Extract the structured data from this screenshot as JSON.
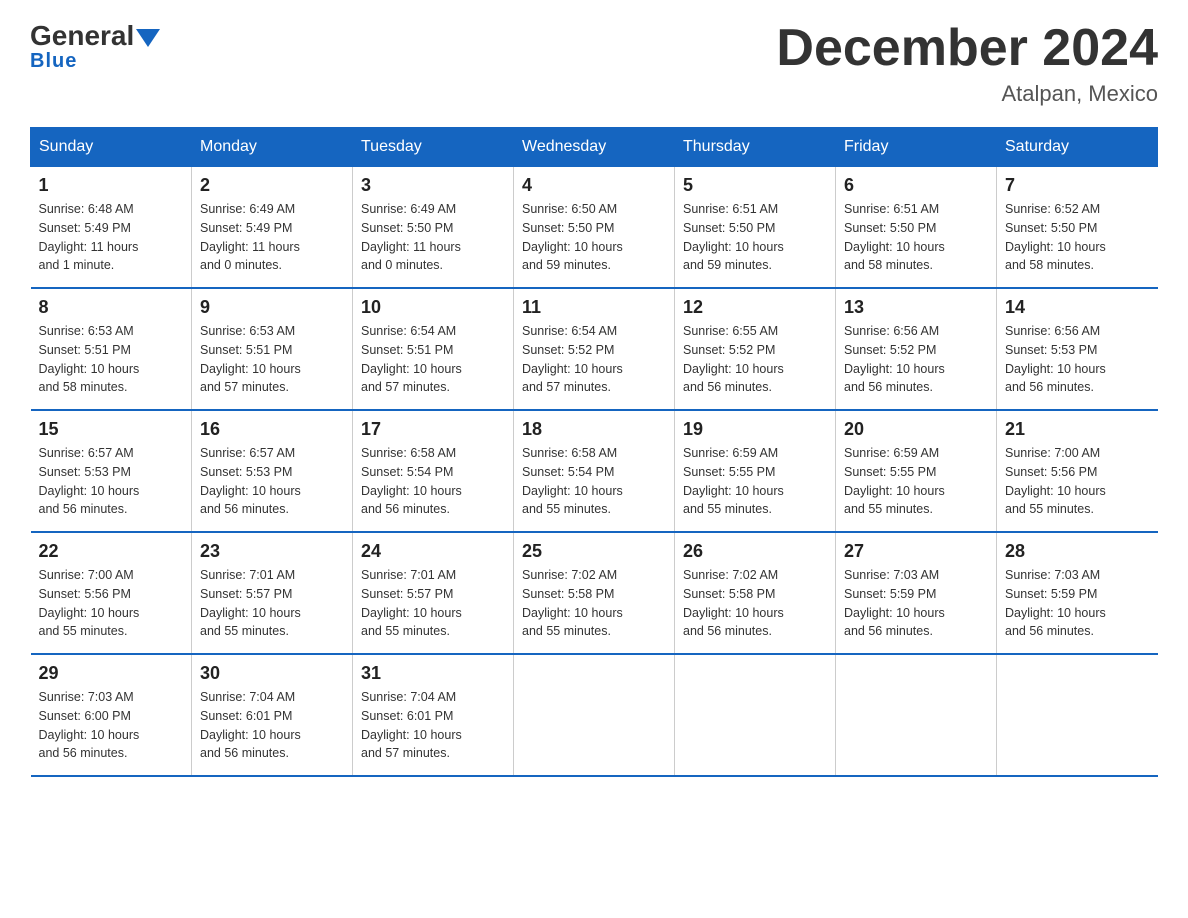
{
  "logo": {
    "general": "General",
    "blue": "Blue",
    "subtitle": "Blue"
  },
  "header": {
    "title": "December 2024",
    "location": "Atalpan, Mexico"
  },
  "days_of_week": [
    "Sunday",
    "Monday",
    "Tuesday",
    "Wednesday",
    "Thursday",
    "Friday",
    "Saturday"
  ],
  "weeks": [
    [
      {
        "day": "1",
        "sunrise": "6:48 AM",
        "sunset": "5:49 PM",
        "daylight": "11 hours and 1 minute."
      },
      {
        "day": "2",
        "sunrise": "6:49 AM",
        "sunset": "5:49 PM",
        "daylight": "11 hours and 0 minutes."
      },
      {
        "day": "3",
        "sunrise": "6:49 AM",
        "sunset": "5:50 PM",
        "daylight": "11 hours and 0 minutes."
      },
      {
        "day": "4",
        "sunrise": "6:50 AM",
        "sunset": "5:50 PM",
        "daylight": "10 hours and 59 minutes."
      },
      {
        "day": "5",
        "sunrise": "6:51 AM",
        "sunset": "5:50 PM",
        "daylight": "10 hours and 59 minutes."
      },
      {
        "day": "6",
        "sunrise": "6:51 AM",
        "sunset": "5:50 PM",
        "daylight": "10 hours and 58 minutes."
      },
      {
        "day": "7",
        "sunrise": "6:52 AM",
        "sunset": "5:50 PM",
        "daylight": "10 hours and 58 minutes."
      }
    ],
    [
      {
        "day": "8",
        "sunrise": "6:53 AM",
        "sunset": "5:51 PM",
        "daylight": "10 hours and 58 minutes."
      },
      {
        "day": "9",
        "sunrise": "6:53 AM",
        "sunset": "5:51 PM",
        "daylight": "10 hours and 57 minutes."
      },
      {
        "day": "10",
        "sunrise": "6:54 AM",
        "sunset": "5:51 PM",
        "daylight": "10 hours and 57 minutes."
      },
      {
        "day": "11",
        "sunrise": "6:54 AM",
        "sunset": "5:52 PM",
        "daylight": "10 hours and 57 minutes."
      },
      {
        "day": "12",
        "sunrise": "6:55 AM",
        "sunset": "5:52 PM",
        "daylight": "10 hours and 56 minutes."
      },
      {
        "day": "13",
        "sunrise": "6:56 AM",
        "sunset": "5:52 PM",
        "daylight": "10 hours and 56 minutes."
      },
      {
        "day": "14",
        "sunrise": "6:56 AM",
        "sunset": "5:53 PM",
        "daylight": "10 hours and 56 minutes."
      }
    ],
    [
      {
        "day": "15",
        "sunrise": "6:57 AM",
        "sunset": "5:53 PM",
        "daylight": "10 hours and 56 minutes."
      },
      {
        "day": "16",
        "sunrise": "6:57 AM",
        "sunset": "5:53 PM",
        "daylight": "10 hours and 56 minutes."
      },
      {
        "day": "17",
        "sunrise": "6:58 AM",
        "sunset": "5:54 PM",
        "daylight": "10 hours and 56 minutes."
      },
      {
        "day": "18",
        "sunrise": "6:58 AM",
        "sunset": "5:54 PM",
        "daylight": "10 hours and 55 minutes."
      },
      {
        "day": "19",
        "sunrise": "6:59 AM",
        "sunset": "5:55 PM",
        "daylight": "10 hours and 55 minutes."
      },
      {
        "day": "20",
        "sunrise": "6:59 AM",
        "sunset": "5:55 PM",
        "daylight": "10 hours and 55 minutes."
      },
      {
        "day": "21",
        "sunrise": "7:00 AM",
        "sunset": "5:56 PM",
        "daylight": "10 hours and 55 minutes."
      }
    ],
    [
      {
        "day": "22",
        "sunrise": "7:00 AM",
        "sunset": "5:56 PM",
        "daylight": "10 hours and 55 minutes."
      },
      {
        "day": "23",
        "sunrise": "7:01 AM",
        "sunset": "5:57 PM",
        "daylight": "10 hours and 55 minutes."
      },
      {
        "day": "24",
        "sunrise": "7:01 AM",
        "sunset": "5:57 PM",
        "daylight": "10 hours and 55 minutes."
      },
      {
        "day": "25",
        "sunrise": "7:02 AM",
        "sunset": "5:58 PM",
        "daylight": "10 hours and 55 minutes."
      },
      {
        "day": "26",
        "sunrise": "7:02 AM",
        "sunset": "5:58 PM",
        "daylight": "10 hours and 56 minutes."
      },
      {
        "day": "27",
        "sunrise": "7:03 AM",
        "sunset": "5:59 PM",
        "daylight": "10 hours and 56 minutes."
      },
      {
        "day": "28",
        "sunrise": "7:03 AM",
        "sunset": "5:59 PM",
        "daylight": "10 hours and 56 minutes."
      }
    ],
    [
      {
        "day": "29",
        "sunrise": "7:03 AM",
        "sunset": "6:00 PM",
        "daylight": "10 hours and 56 minutes."
      },
      {
        "day": "30",
        "sunrise": "7:04 AM",
        "sunset": "6:01 PM",
        "daylight": "10 hours and 56 minutes."
      },
      {
        "day": "31",
        "sunrise": "7:04 AM",
        "sunset": "6:01 PM",
        "daylight": "10 hours and 57 minutes."
      },
      null,
      null,
      null,
      null
    ]
  ],
  "labels": {
    "sunrise": "Sunrise:",
    "sunset": "Sunset:",
    "daylight": "Daylight:"
  }
}
